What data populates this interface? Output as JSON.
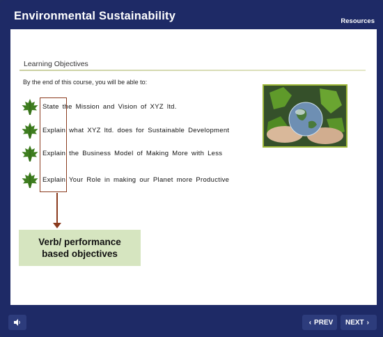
{
  "header": {
    "title": "Environmental Sustainability",
    "resources_label": "Resources"
  },
  "slide": {
    "section_title": "Learning Objectives",
    "intro": "By the end of this course, you will be able to:",
    "objectives": [
      "State the Mission and Vision of XYZ ltd.",
      "Explain what XYZ ltd. does for Sustainable Development",
      "Explain the Business Model of Making More with Less",
      "Explain Your Role in making our Planet more Productive"
    ],
    "callout": {
      "line1": "Verb/ performance",
      "line2": "based objectives"
    }
  },
  "footer": {
    "prev_label": "PREV",
    "next_label": "NEXT"
  },
  "icons": {
    "leaf": "maple-leaf-icon",
    "audio": "speaker-icon",
    "prev": "chevron-left-icon",
    "next": "chevron-right-icon"
  },
  "colors": {
    "frame": "#1e2a66",
    "button": "#2d3c7c",
    "highlight_box": "#8a3a1d",
    "callout_bg": "#d6e5c0",
    "leaf": "#3e7d1f",
    "rule": "#c9cfa0"
  }
}
